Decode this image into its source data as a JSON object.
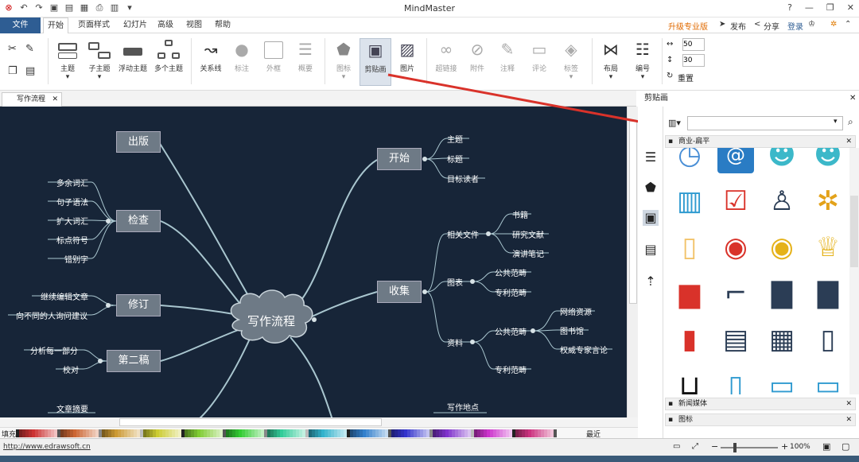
{
  "app": {
    "title": "MindMaster"
  },
  "quick_access": [
    "logo-icon",
    "undo-icon",
    "redo-icon",
    "new-icon",
    "open-icon",
    "save-icon",
    "print-icon",
    "export-icon",
    "more-icon"
  ],
  "menu": {
    "file": "文件",
    "tabs": [
      "开始",
      "页面样式",
      "幻灯片",
      "高级",
      "视图",
      "帮助"
    ],
    "active_tab": "开始",
    "upgrade": "升级专业版",
    "publish": "发布",
    "share": "分享",
    "login": "登录"
  },
  "ribbon": {
    "main_topic": "主题",
    "sub_topic": "子主题",
    "float_topic": "浮动主题",
    "multi_topic": "多个主题",
    "relation": "关系线",
    "callout": "标注",
    "boundary": "外框",
    "summary": "概要",
    "icon": "图标",
    "clipart": "剪贴画",
    "picture": "图片",
    "hyperlink": "超链接",
    "attachment": "附件",
    "note": "注释",
    "comment": "评论",
    "tag": "标签",
    "layout": "布局",
    "numbering": "编号",
    "spacing_h": "50",
    "spacing_v": "30",
    "reset": "重置"
  },
  "doc_tab": {
    "label": "写作流程"
  },
  "mindmap": {
    "center": "写作流程",
    "left": [
      {
        "label": "出版",
        "children": []
      },
      {
        "label": "检查",
        "children": [
          "多余词汇",
          "句子语法",
          "扩大词汇",
          "标点符号",
          "错别字"
        ]
      },
      {
        "label": "修订",
        "children": [
          "继续编辑文章",
          "向不同的人询问建议"
        ]
      },
      {
        "label": "第二稿",
        "children": [
          "分析每一部分",
          "校对"
        ]
      },
      {
        "label": "",
        "children": [
          "文章摘要"
        ]
      }
    ],
    "right": [
      {
        "label": "开始",
        "children": [
          "主题",
          "标题",
          "目标读者"
        ]
      },
      {
        "label": "收集",
        "groups": [
          {
            "label": "相关文件",
            "children": [
              "书籍",
              "研究文献",
              "演讲笔记"
            ]
          },
          {
            "label": "图表",
            "children": [
              "公共范畴",
              "专利范畴"
            ]
          },
          {
            "label": "资料",
            "children": [
              "公共范畴",
              "专利范畴"
            ],
            "sub": [
              "网络资源",
              "图书馆",
              "权威专家言论"
            ]
          }
        ]
      },
      {
        "label": "",
        "children": [
          "写作地点"
        ]
      }
    ]
  },
  "colorbar": {
    "fill_label": "填充",
    "recent_label": "最近"
  },
  "status": {
    "url": "http://www.edrawsoft.cn",
    "zoom": "100%"
  },
  "panel": {
    "title": "剪贴画",
    "search_placeholder": "",
    "category": "商业-扁平",
    "sections": [
      "新闻媒体",
      "图标"
    ],
    "items": [
      "clock-icon",
      "email-icon",
      "head-gear-icon",
      "head-lightbulb-icon",
      "binders-icon",
      "checkbox-icon",
      "office-chair-icon",
      "network-people-icon",
      "luggage-icon",
      "medal-red-icon",
      "medal-gold-icon",
      "trophy-icon",
      "podium-icon",
      "stairs-icon",
      "bar-chart-down-icon",
      "bar-chart-arrow-down-icon",
      "bar-chart-up-icon",
      "receipt-icon",
      "cash-register-icon",
      "phone-hand-icon",
      "shopping-cart-icon",
      "mobile-cart-icon",
      "monitor-cart-icon",
      "laptop-cart-icon"
    ]
  },
  "colors": {
    "canvas": "#172538",
    "branch": "#a9c6cf",
    "topic": "#6e7a86",
    "accent": "#2e5d93",
    "arrow": "#d9322a"
  }
}
